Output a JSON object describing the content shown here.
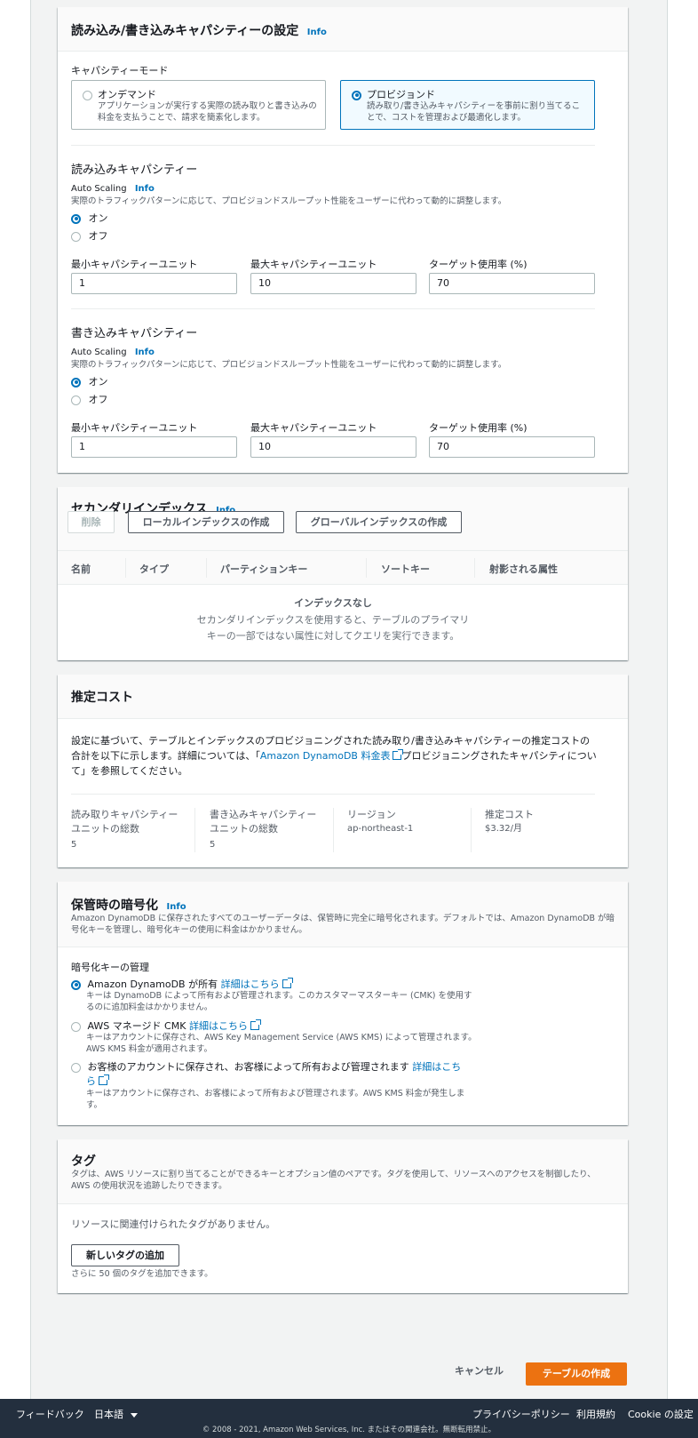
{
  "capacity_settings": {
    "title": "読み込み/書き込みキャパシティーの設定",
    "info": "Info",
    "mode_label": "キャパシティーモード",
    "on_demand": {
      "title": "オンデマンド",
      "desc_line1": "アプリケーションが実行する実際の読み取りと書き込みの",
      "desc_line2": "料金を支払うことで、請求を簡素化します。"
    },
    "provisioned": {
      "title": "プロビジョンド",
      "desc_line1": "読み取り/書き込みキャパシティーを事前に割り当てるこ",
      "desc_line2": "とで、コストを管理および最適化します。"
    },
    "read": {
      "title": "読み込みキャパシティー",
      "autoscaling": "Auto Scaling",
      "info": "Info",
      "desc": "実際のトラフィックパターンに応じて、プロビジョンドスループット性能をユーザーに代わって動的に調整します。",
      "on": "オン",
      "off": "オフ",
      "min_label": "最小キャパシティーユニット",
      "max_label": "最大キャパシティーユニット",
      "target_label": "ターゲット使用率 (%)",
      "min": "1",
      "max": "10",
      "target": "70"
    },
    "write": {
      "title": "書き込みキャパシティー",
      "autoscaling": "Auto Scaling",
      "info": "Info",
      "desc": "実際のトラフィックパターンに応じて、プロビジョンドスループット性能をユーザーに代わって動的に調整します。",
      "on": "オン",
      "off": "オフ",
      "min_label": "最小キャパシティーユニット",
      "max_label": "最大キャパシティーユニット",
      "target_label": "ターゲット使用率 (%)",
      "min": "1",
      "max": "10",
      "target": "70"
    }
  },
  "secondary_index": {
    "title": "セカンダリインデックス",
    "info": "Info",
    "delete_btn": "削除",
    "local_btn": "ローカルインデックスの作成",
    "global_btn": "グローバルインデックスの作成",
    "columns": [
      "名前",
      "タイプ",
      "パーティションキー",
      "ソートキー",
      "射影される属性"
    ],
    "empty_title": "インデックスなし",
    "empty_line1": "セカンダリインデックスを使用すると、テーブルのプライマリ",
    "empty_line2": "キーの一部ではない属性に対してクエリを実行できます。"
  },
  "estimated_cost": {
    "title": "推定コスト",
    "body_line1": "設定に基づいて、テーブルとインデックスのプロビジョニングされた読み取り/書き込みキャパシティーの推定コストの",
    "body_line2_pre": "合計を以下に示します。詳細については、「",
    "body_link": "Amazon DynamoDB 料金表",
    "body_line2_post": "プロビジョニングされたキャパシティについ",
    "body_line3": "て」を参照してください。",
    "read_label_1": "読み取りキャパシティー",
    "read_label_2": "ユニットの総数",
    "read_value": "5",
    "write_label_1": "書き込みキャパシティー",
    "write_label_2": "ユニットの総数",
    "write_value": "5",
    "region_label": "リージョン",
    "region_value": "ap-northeast-1",
    "cost_label": "推定コスト",
    "cost_value": "$3.32/月"
  },
  "encryption": {
    "title": "保管時の暗号化",
    "info": "Info",
    "desc_line1": "Amazon DynamoDB に保存されたすべてのユーザーデータは、保管時に完全に暗号化されます。デフォルトでは、Amazon DynamoDB が暗",
    "desc_line2": "号化キーを管理し、暗号化キーの使用に料金はかかりません。",
    "key_mgmt_label": "暗号化キーの管理",
    "learn_more": "詳細はこちら",
    "opt1_title": "Amazon DynamoDB が所有",
    "opt1_desc1": "キーは DynamoDB によって所有および管理されます。このカスタマーマスターキー (CMK) を使用す",
    "opt1_desc2": "るのに追加料金はかかりません。",
    "opt2_title": "AWS マネージド CMK",
    "opt2_desc1": "キーはアカウントに保存され、AWS Key Management Service (AWS KMS) によって管理されます。",
    "opt2_desc2": "AWS KMS 料金が適用されます。",
    "opt3_title": "お客様のアカウントに保存され、お客様によって所有および管理されます",
    "opt3_link_a": "詳細はこち",
    "opt3_link_b": "ら",
    "opt3_desc1": "キーはアカウントに保存され、お客様によって所有および管理されます。AWS KMS 料金が発生しま",
    "opt3_desc2": "す。"
  },
  "tags": {
    "title": "タグ",
    "desc_line1": "タグは、AWS リソースに割り当てることができるキーとオプション値のペアです。タグを使用して、リソースへのアクセスを制御したり、",
    "desc_line2": "AWS の使用状況を追跡したりできます。",
    "empty": "リソースに関連付けられたタグがありません。",
    "add_btn": "新しいタグの追加",
    "hint": "さらに 50 個のタグを追加できます。"
  },
  "actions": {
    "cancel": "キャンセル",
    "create": "テーブルの作成"
  },
  "footer": {
    "feedback": "フィードバック",
    "language": "日本語",
    "privacy": "プライバシーポリシー",
    "terms": "利用規約",
    "cookie": "Cookie の設定",
    "copyright": "© 2008 - 2021, Amazon Web Services, Inc. またはその関連会社。無断転用禁止。"
  },
  "colors": {
    "accent": "#0073bb",
    "primary_button": "#ec7211",
    "footer_bg": "#232f3e"
  }
}
